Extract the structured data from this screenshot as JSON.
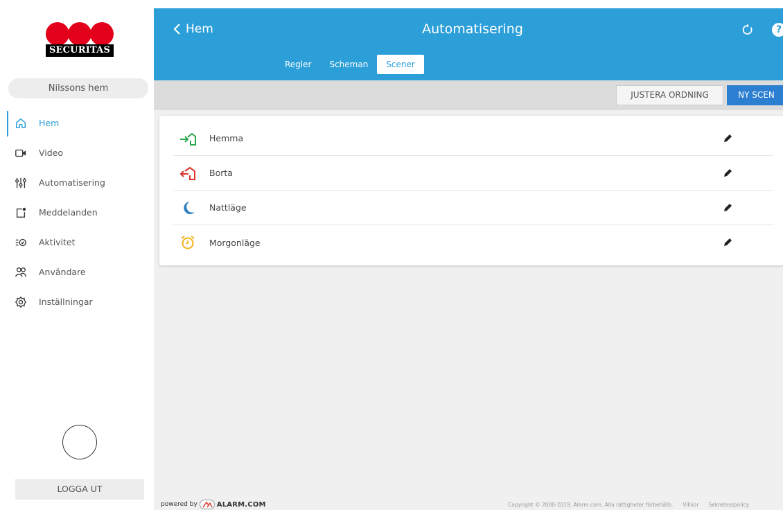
{
  "brand": {
    "logo_text": "SECURITAS",
    "logo_color": "#e3001b"
  },
  "sidebar": {
    "home_selector": "Nilssons hem",
    "items": [
      {
        "label": "Hem",
        "icon": "home-icon",
        "active": true
      },
      {
        "label": "Video",
        "icon": "video-icon"
      },
      {
        "label": "Automatisering",
        "icon": "sliders-icon"
      },
      {
        "label": "Meddelanden",
        "icon": "notification-icon"
      },
      {
        "label": "Aktivitet",
        "icon": "activity-icon"
      },
      {
        "label": "Användare",
        "icon": "users-icon"
      },
      {
        "label": "Inställningar",
        "icon": "gear-icon"
      }
    ],
    "logout_label": "LOGGA UT"
  },
  "header": {
    "back_label": "Hem",
    "title": "Automatisering",
    "tabs": [
      {
        "label": "Regler"
      },
      {
        "label": "Scheman"
      },
      {
        "label": "Scener",
        "selected": true
      }
    ],
    "accent_color": "#2c9fd9"
  },
  "toolbar": {
    "reorder_label": "JUSTERA ORDNING",
    "new_label": "NY SCEN"
  },
  "scenes": [
    {
      "name": "Hemma",
      "icon": "arrive-home-icon",
      "color": "#2aa84a"
    },
    {
      "name": "Borta",
      "icon": "leave-home-icon",
      "color": "#d9332b"
    },
    {
      "name": "Nattläge",
      "icon": "moon-icon",
      "color": "#2c7fc0"
    },
    {
      "name": "Morgonläge",
      "icon": "alarm-clock-icon",
      "color": "#f2b21b"
    }
  ],
  "footer": {
    "powered_by": "powered by",
    "powered_brand": "ALARM.COM",
    "copyright": "Copyright © 2000-2019, Alarm.com. Alla rättigheter förbehålls.",
    "terms": "Villkor",
    "privacy": "Sekretesspolicy"
  }
}
